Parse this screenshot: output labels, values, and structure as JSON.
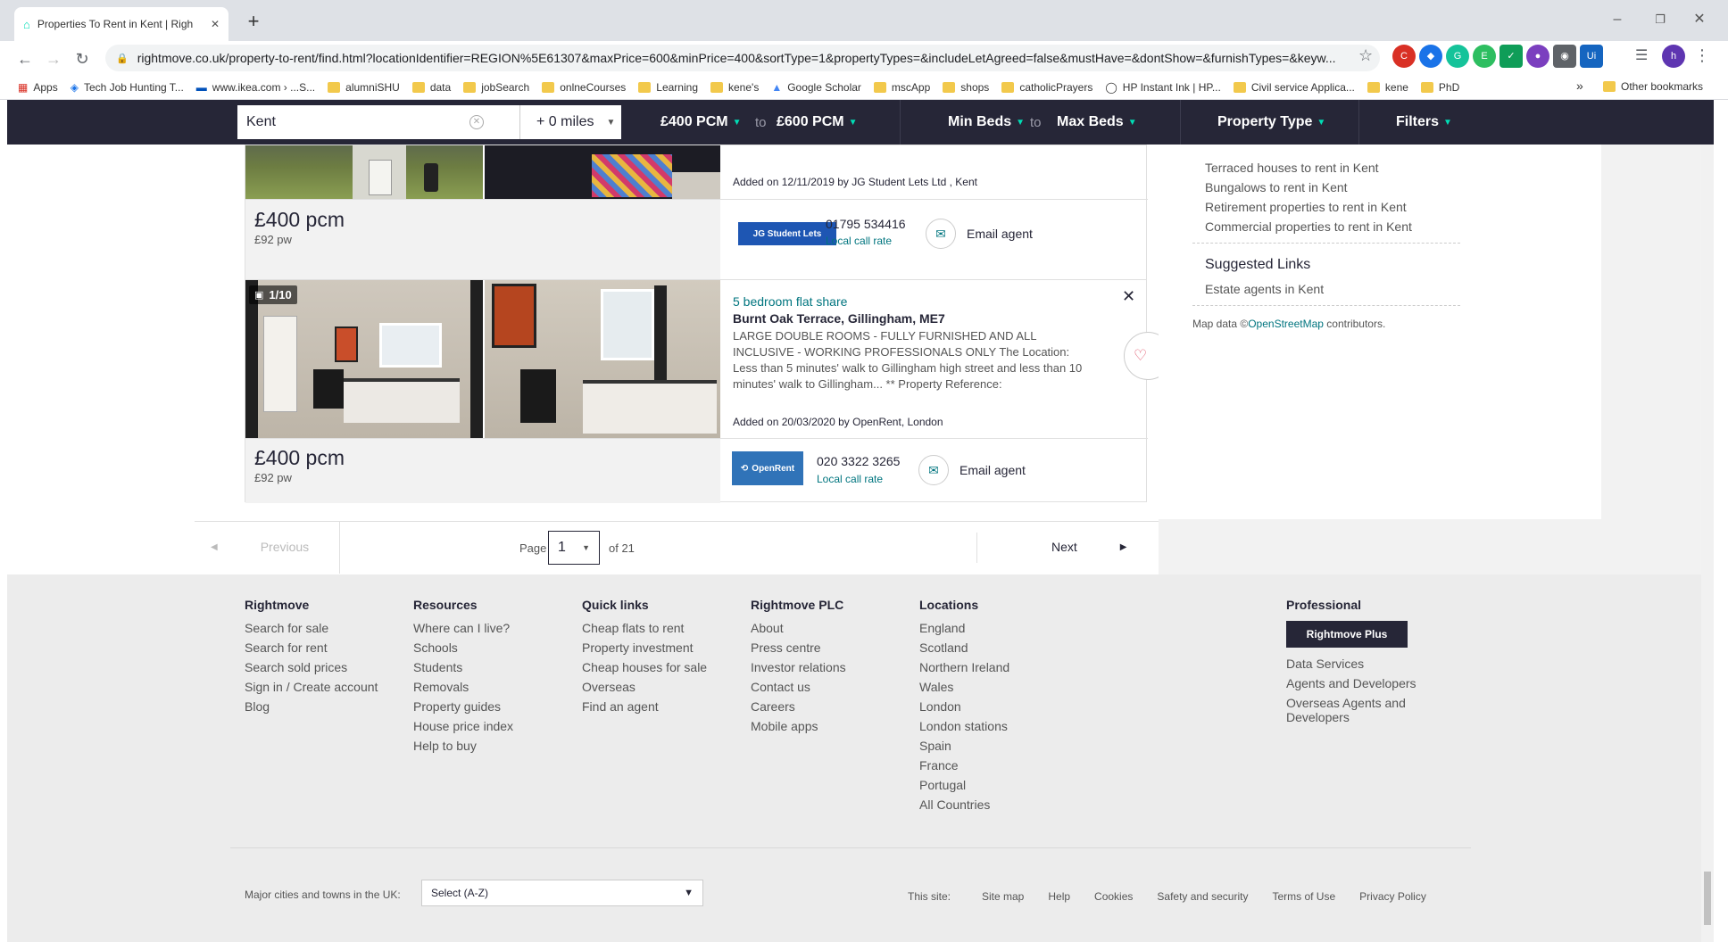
{
  "browser": {
    "tab_title": "Properties To Rent in Kent | Righ",
    "url": "rightmove.co.uk/property-to-rent/find.html?locationIdentifier=REGION%5E61307&maxPrice=600&minPrice=400&sortType=1&propertyTypes=&includeLetAgreed=false&mustHave=&dontShow=&furnishTypes=&keyw...",
    "bookmarks": [
      {
        "label": "Apps",
        "icon": "apps-grid-icon"
      },
      {
        "label": "Tech Job Hunting T...",
        "icon": "colorful-bookmark-icon"
      },
      {
        "label": "www.ikea.com › ...S...",
        "icon": "ikea-icon"
      },
      {
        "label": "alumniSHU",
        "icon": "folder-icon"
      },
      {
        "label": "data",
        "icon": "folder-icon"
      },
      {
        "label": "jobSearch",
        "icon": "folder-icon"
      },
      {
        "label": "onlneCourses",
        "icon": "folder-icon"
      },
      {
        "label": "Learning",
        "icon": "folder-icon"
      },
      {
        "label": "kene's",
        "icon": "folder-icon"
      },
      {
        "label": "Google Scholar",
        "icon": "scholar-icon"
      },
      {
        "label": "mscApp",
        "icon": "folder-icon"
      },
      {
        "label": "shops",
        "icon": "folder-icon"
      },
      {
        "label": "catholicPrayers",
        "icon": "folder-icon"
      },
      {
        "label": "HP Instant Ink | HP...",
        "icon": "hp-icon"
      },
      {
        "label": "Civil service Applica...",
        "icon": "folder-icon"
      },
      {
        "label": "kene",
        "icon": "folder-icon"
      },
      {
        "label": "PhD",
        "icon": "folder-icon"
      }
    ],
    "overflow_label": "»",
    "other_bookmarks": "Other bookmarks",
    "profile_initial": "h"
  },
  "search": {
    "location": "Kent",
    "radius": "+ 0 miles",
    "min_price": "£400 PCM",
    "max_price": "£600 PCM",
    "to": "to",
    "min_beds": "Min Beds",
    "max_beds": "Max Beds",
    "property_type": "Property Type",
    "filters": "Filters"
  },
  "listing1": {
    "added": "Added on 12/11/2019 by JG Student Lets Ltd , Kent",
    "price": "£400 pcm",
    "pw": "£92 pw",
    "agent_logo": "JG Student Lets",
    "phone": "01795 534416",
    "local": "Local call rate",
    "email": "Email agent"
  },
  "listing2": {
    "photo_count": "1/10",
    "title": "5 bedroom flat share",
    "address": "Burnt Oak Terrace, Gillingham, ME7",
    "description": "LARGE DOUBLE ROOMS - FULLY FURNISHED AND ALL INCLUSIVE - WORKING PROFESSIONALS ONLY The Location: Less than 5 minutes' walk to Gillingham high street and less than 10 minutes' walk to Gillingham... ** Property Reference:",
    "added": "Added on 20/03/2020 by OpenRent, London",
    "price": "£400 pcm",
    "pw": "£92 pw",
    "agent_logo": "OpenRent",
    "phone": "020 3322 3265",
    "local": "Local call rate",
    "email": "Email agent"
  },
  "sidebar": {
    "links": [
      "Terraced houses to rent in Kent",
      "Bungalows to rent in Kent",
      "Retirement properties to rent in Kent",
      "Commercial properties to rent in Kent"
    ],
    "suggested_heading": "Suggested Links",
    "suggested": [
      "Estate agents in Kent"
    ],
    "map_prefix": "Map data ©",
    "map_link": "OpenStreetMap",
    "map_suffix": " contributors."
  },
  "pagination": {
    "previous": "Previous",
    "page_label": "Page",
    "current": "1",
    "of": "of 21",
    "next": "Next"
  },
  "footer": {
    "columns": [
      {
        "heading": "Rightmove",
        "links": [
          "Search for sale",
          "Search for rent",
          "Search sold prices",
          "Sign in / Create account",
          "Blog"
        ]
      },
      {
        "heading": "Resources",
        "links": [
          "Where can I live?",
          "Schools",
          "Students",
          "Removals",
          "Property guides",
          "House price index",
          "Help to buy"
        ]
      },
      {
        "heading": "Quick links",
        "links": [
          "Cheap flats to rent",
          "Property investment",
          "Cheap houses for sale",
          "Overseas",
          "Find an agent"
        ]
      },
      {
        "heading": "Rightmove PLC",
        "links": [
          "About",
          "Press centre",
          "Investor relations",
          "Contact us",
          "Careers",
          "Mobile apps"
        ]
      },
      {
        "heading": "Locations",
        "links": [
          "England",
          "Scotland",
          "Northern Ireland",
          "Wales",
          "London",
          "London stations",
          "Spain",
          "France",
          "Portugal",
          "All Countries"
        ]
      }
    ],
    "professional": {
      "heading": "Professional",
      "button": "Rightmove Plus",
      "links": [
        "Data Services",
        "Agents and Developers",
        "Overseas Agents and Developers"
      ]
    },
    "cities_label": "Major cities and towns in the UK:",
    "cities_select": "Select (A-Z)",
    "this_site": "This site:",
    "bottom_links": [
      "Site map",
      "Help",
      "Cookies",
      "Safety and security",
      "Terms of Use",
      "Privacy Policy"
    ]
  }
}
